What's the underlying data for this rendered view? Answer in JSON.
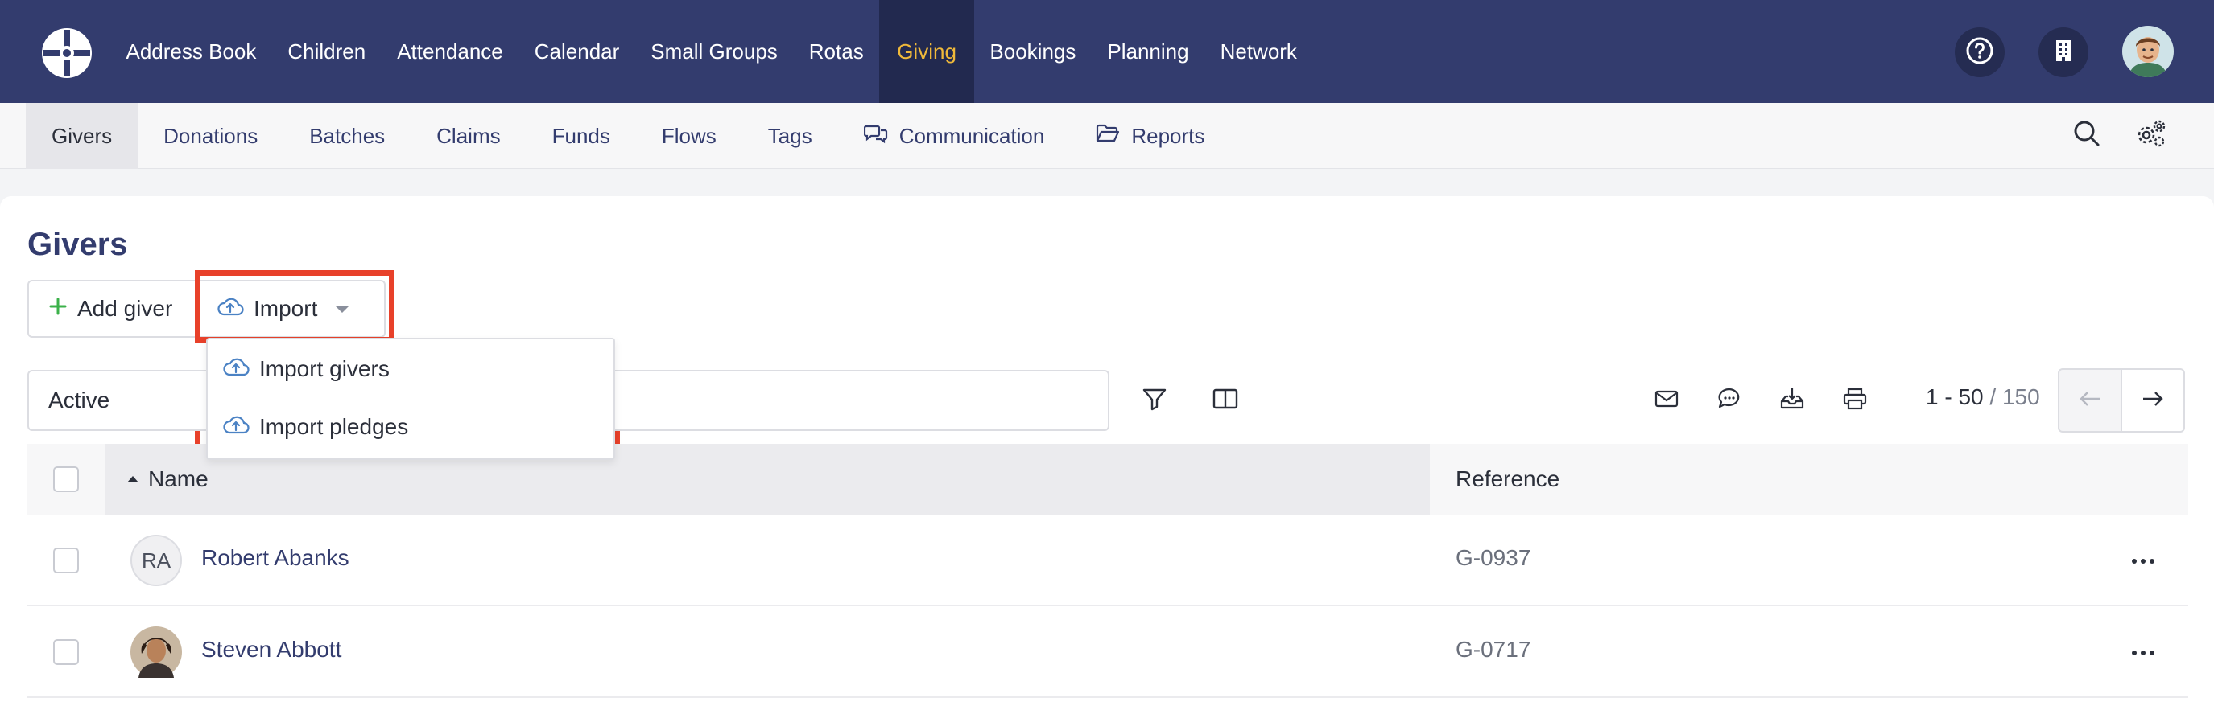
{
  "main_nav": {
    "items": [
      "Address Book",
      "Children",
      "Attendance",
      "Calendar",
      "Small Groups",
      "Rotas",
      "Giving",
      "Bookings",
      "Planning",
      "Network"
    ],
    "active": "Giving"
  },
  "top_icons": [
    "help-icon",
    "building-icon",
    "user-avatar"
  ],
  "sub_nav": {
    "items": [
      "Givers",
      "Donations",
      "Batches",
      "Claims",
      "Funds",
      "Flows",
      "Tags",
      "Communication",
      "Reports"
    ],
    "active": "Givers"
  },
  "page": {
    "title": "Givers"
  },
  "actions": {
    "add_label": "Add giver",
    "import_label": "Import"
  },
  "import_menu": {
    "items": [
      "Import givers",
      "Import pledges"
    ]
  },
  "filter": {
    "status": "Active"
  },
  "pager": {
    "range": "1 - 50",
    "total": "/ 150"
  },
  "table": {
    "columns": [
      "Name",
      "Reference"
    ],
    "rows": [
      {
        "initials": "RA",
        "name": "Robert Abanks",
        "reference": "G-0937"
      },
      {
        "initials": "",
        "name": "Steven Abbott",
        "reference": "G-0717"
      }
    ]
  },
  "colors": {
    "nav_bg": "#333c6e",
    "nav_active_bg": "#22294f",
    "active_text": "#f0b93a",
    "highlight": "#e8412a",
    "link": "#333c6e"
  }
}
